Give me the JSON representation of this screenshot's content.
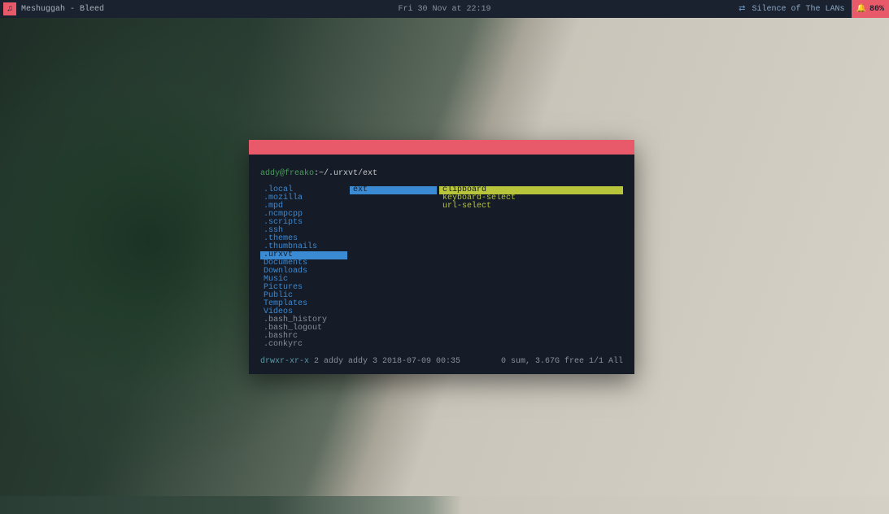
{
  "topbar": {
    "music_icon": "♫",
    "music_text": "Meshuggah - Bleed",
    "time": "Fri 30 Nov at 22:19",
    "net_icon": "⇄",
    "net_name": "Silence of The LANs",
    "bell_icon": "🔔",
    "battery": "80%"
  },
  "terminal": {
    "user": "addy@freako",
    "sep": ":",
    "path": "~/.urxvt/ext",
    "col1": [
      {
        "name": ".local",
        "type": "dir"
      },
      {
        "name": ".mozilla",
        "type": "dir"
      },
      {
        "name": ".mpd",
        "type": "dir"
      },
      {
        "name": ".ncmpcpp",
        "type": "dir"
      },
      {
        "name": ".scripts",
        "type": "dir"
      },
      {
        "name": ".ssh",
        "type": "dir"
      },
      {
        "name": ".themes",
        "type": "dir"
      },
      {
        "name": ".thumbnails",
        "type": "dir"
      },
      {
        "name": ".urxvt",
        "type": "dir",
        "selected": true
      },
      {
        "name": "Documents",
        "type": "dir"
      },
      {
        "name": "Downloads",
        "type": "dir"
      },
      {
        "name": "Music",
        "type": "dir"
      },
      {
        "name": "Pictures",
        "type": "dir"
      },
      {
        "name": "Public",
        "type": "dir"
      },
      {
        "name": "Templates",
        "type": "dir"
      },
      {
        "name": "Videos",
        "type": "dir"
      },
      {
        "name": ".bash_history",
        "type": "file"
      },
      {
        "name": ".bash_logout",
        "type": "file"
      },
      {
        "name": ".bashrc",
        "type": "file"
      },
      {
        "name": ".conkyrc",
        "type": "file"
      }
    ],
    "col2": [
      {
        "name": "ext",
        "type": "dir",
        "selected": true
      }
    ],
    "col3": [
      {
        "name": "clipboard",
        "type": "exec",
        "selected": true
      },
      {
        "name": "keyboard-select",
        "type": "exec"
      },
      {
        "name": "url-select",
        "type": "exec"
      }
    ],
    "status": {
      "perms": "drwxr-xr-x",
      "details": "2 addy addy 3 2018-07-09 00:35",
      "right": "0 sum, 3.67G free  1/1  All"
    }
  }
}
